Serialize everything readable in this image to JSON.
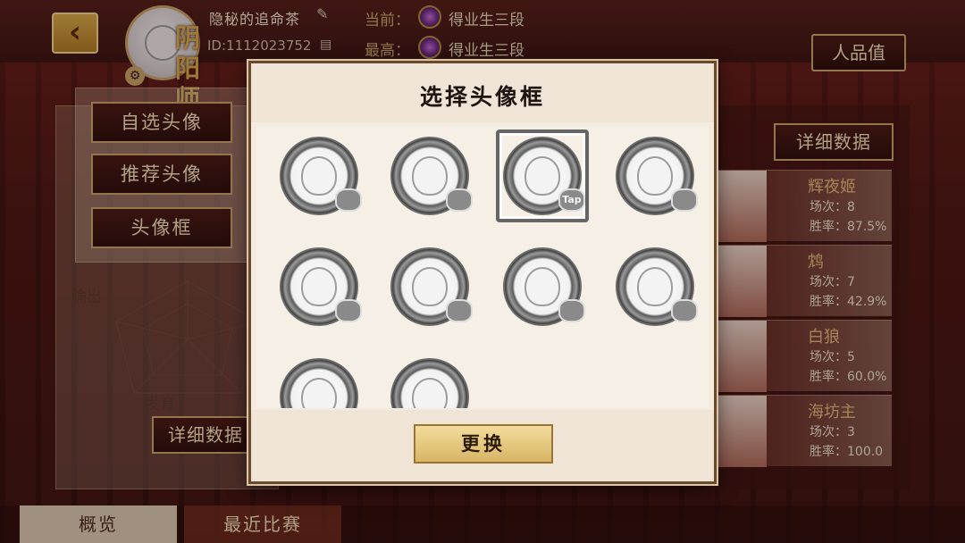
{
  "player": {
    "name": "隐秘的追命茶",
    "id": "ID:1112023752",
    "rank_tag": "阴阳师",
    "current_label": "当前：",
    "current_rank": "得业生三段",
    "best_label": "最高：",
    "best_rank": "得业生三段"
  },
  "header": {
    "renpin_label": "人品值"
  },
  "left_menu": {
    "items": [
      {
        "label": "自选头像"
      },
      {
        "label": "推荐头像"
      },
      {
        "label": "头像框"
      }
    ]
  },
  "stats": {
    "output_label": "输出",
    "growth_label": "发育",
    "detail_label": "详细数据"
  },
  "right_panel": {
    "detail_label": "详细数据",
    "heroes": [
      {
        "name": "辉夜姬",
        "games": "场次：8",
        "winrate": "胜率：87.5%"
      },
      {
        "name": "鸩",
        "games": "场次：7",
        "winrate": "胜率：42.9%"
      },
      {
        "name": "白狼",
        "games": "场次：5",
        "winrate": "胜率：60.0%"
      },
      {
        "name": "海坊主",
        "games": "场次：3",
        "winrate": "胜率：100.0"
      }
    ]
  },
  "tabs": {
    "overview": "概览",
    "recent": "最近比赛"
  },
  "modal": {
    "title": "选择头像框",
    "change_label": "更换",
    "frames": [
      {
        "deco": ""
      },
      {
        "deco": ""
      },
      {
        "deco": "Tap",
        "selected": true
      },
      {
        "deco": ""
      },
      {
        "deco": ""
      },
      {
        "deco": ""
      },
      {
        "deco": ""
      },
      {
        "deco": ""
      },
      {
        "deco": ""
      },
      {
        "deco": ""
      }
    ]
  },
  "icons": {
    "back": "chevron-left-icon",
    "edit": "pencil-icon",
    "copy": "copy-icon",
    "settings": "gear-icon"
  },
  "colors": {
    "accent_gold": "#c9a36a",
    "modal_bg": "#f3ebe0",
    "button_gold": "#d8b565",
    "dark_red": "#3b1512"
  }
}
